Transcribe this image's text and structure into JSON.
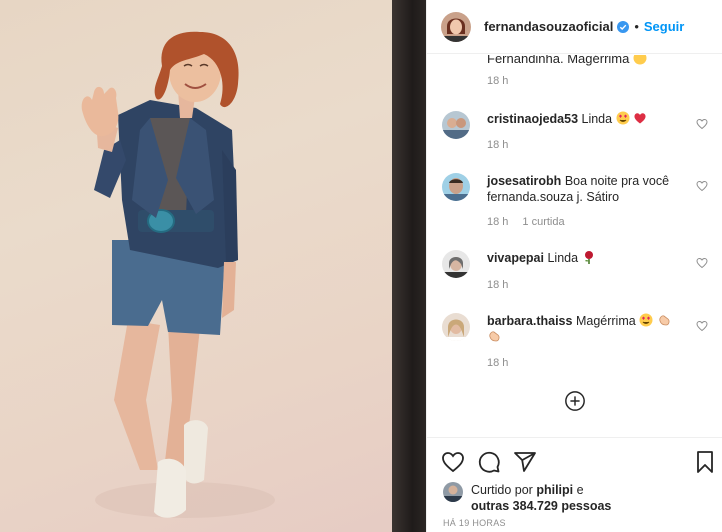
{
  "header": {
    "username": "fernandasouzaoficial",
    "separator": "•",
    "follow_label": "Seguir"
  },
  "partial_comment": "Fernandinha. Magérrima",
  "partial_time": "18 h",
  "comments": [
    {
      "username": "cristinaojeda53",
      "text": "Linda",
      "time": "18 h",
      "reply": ""
    },
    {
      "username": "josesatirobh",
      "text": "Boa noite pra você fernanda.souza j. Sátiro",
      "time": "18 h",
      "reply": "1 curtida"
    },
    {
      "username": "vivapepai",
      "text": "Linda",
      "time": "18 h",
      "reply": ""
    },
    {
      "username": "barbara.thaiss",
      "text": "Magérrima",
      "time": "18 h",
      "reply": ""
    }
  ],
  "likes": {
    "prefix": "Curtido por",
    "user": "philipi",
    "conj": "e",
    "others": "outras 384.729 pessoas"
  },
  "timestamp": "HÁ 19 HORAS",
  "colors": {
    "accent": "#0095f6",
    "text": "#262626",
    "muted": "#8e8e8e",
    "divider": "#efefef"
  },
  "icons": [
    "verified-badge-icon",
    "heart-icon",
    "comment-icon",
    "share-icon",
    "bookmark-icon",
    "plus-circle-icon"
  ]
}
